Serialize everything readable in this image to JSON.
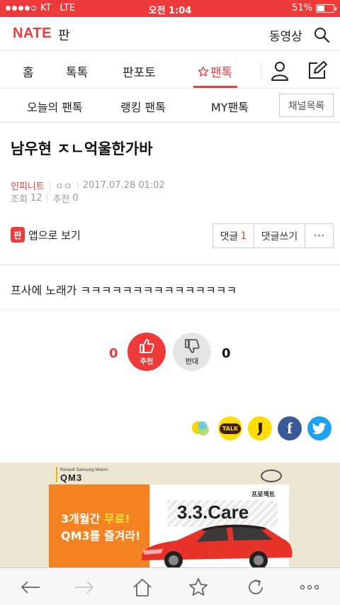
{
  "status_bar": {
    "carrier": "KT",
    "network": "LTE",
    "time": "오전 1:04",
    "battery": "51%",
    "battery_level": 0.51
  },
  "header": {
    "logo": "NATE",
    "section": "판",
    "video_link": "동영상"
  },
  "tabs": [
    {
      "label": "홈"
    },
    {
      "label": "톡톡"
    },
    {
      "label": "판포토"
    },
    {
      "label": "팬톡",
      "active": true
    }
  ],
  "subtabs": {
    "today": "오늘의 팬톡",
    "ranking": "랭킹 팬톡",
    "my": "MY팬톡",
    "channel_list": "채널목록"
  },
  "post": {
    "title": "남우현 ㅈㄴ억울한가바",
    "author": "인피니트",
    "author_sub": "ㅇㅇ",
    "date": "2017.07.28 01:02",
    "views_label": "조회",
    "views": "12",
    "recommend_label": "추천",
    "recommend": "0",
    "body": "프사에 노래가 ㅋㅋㅋㅋㅋㅋㅋㅋㅋㅋㅋㅋㅋㅋㅋ"
  },
  "actions": {
    "app_icon": "판",
    "app_view": "앱으로 보기",
    "comment_label": "댓글",
    "comment_count": "1",
    "write_comment": "댓글쓰기",
    "more": "···"
  },
  "votes": {
    "up_count": "0",
    "up_label": "추천",
    "down_label": "반대",
    "down_count": "0"
  },
  "share": {
    "kakaotalk_label": "TALK",
    "facebook_label": "f"
  },
  "ad": {
    "brand_small": "Renault Samsung Motors",
    "brand": "QM3",
    "project": "프로젝트",
    "care": "3.3.Care",
    "line1_a": "3개월간 ",
    "line1_b": "무료!",
    "line2": "QM3를 즐겨라!"
  },
  "colors": {
    "accent": "#ee3a3a",
    "facebook": "#3b5998",
    "twitter": "#1da1f2",
    "kakao": "#ffde00"
  },
  "icons": {
    "search": "search-icon",
    "user": "user-icon",
    "write": "edit-icon",
    "star": "star-icon",
    "thumb_up": "thumbs-up-icon",
    "thumb_down": "thumbs-down-icon",
    "back": "arrow-left-icon",
    "forward": "arrow-right-icon",
    "home": "home-icon",
    "bookmark": "star-icon",
    "refresh": "refresh-icon",
    "more": "more-icon"
  }
}
